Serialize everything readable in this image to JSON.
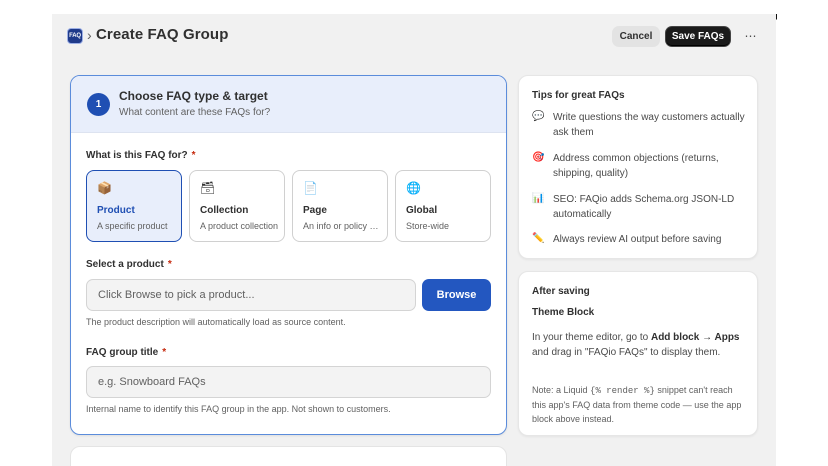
{
  "header": {
    "app_icon_text": "FAQ",
    "breadcrumb_sep": "›",
    "title": "Create FAQ Group",
    "cancel_label": "Cancel",
    "save_label": "Save FAQs",
    "more_label": "⋯"
  },
  "step": {
    "number": "1",
    "title": "Choose FAQ type & target",
    "subtitle": "What content are these FAQs for?"
  },
  "faq_type": {
    "label": "What is this FAQ for?",
    "required_mark": "*",
    "selected": "Product",
    "options": [
      {
        "name": "Product",
        "desc": "A specific product",
        "icon": "package-icon",
        "glyph": "📦"
      },
      {
        "name": "Collection",
        "desc": "A product collection",
        "icon": "collection-icon",
        "glyph": "🗃"
      },
      {
        "name": "Page",
        "desc": "An info or policy page",
        "icon": "page-icon",
        "glyph": "📄"
      },
      {
        "name": "Global",
        "desc": "Store-wide",
        "icon": "globe-icon",
        "glyph": "🌐"
      }
    ]
  },
  "product": {
    "label": "Select a product",
    "required_mark": "*",
    "placeholder": "Click Browse to pick a product...",
    "browse_label": "Browse",
    "help": "The product description will automatically load as source content."
  },
  "group_title": {
    "label": "FAQ group title",
    "required_mark": "*",
    "placeholder": "e.g. Snowboard FAQs",
    "help": "Internal name to identify this FAQ group in the app. Not shown to customers."
  },
  "tips": {
    "title": "Tips for great FAQs",
    "items": [
      {
        "icon": "speech-bubble-icon",
        "glyph": "💬",
        "text": "Write questions the way customers actually ask them"
      },
      {
        "icon": "target-icon",
        "glyph": "🎯",
        "text": "Address common objections (returns, shipping, quality)"
      },
      {
        "icon": "chart-icon",
        "glyph": "📊",
        "text": "SEO: FAQio adds Schema.org JSON-LD automatically"
      },
      {
        "icon": "pencil-icon",
        "glyph": "✏️",
        "text": "Always review AI output before saving"
      }
    ]
  },
  "after_saving": {
    "title": "After saving",
    "subtitle": "Theme Block",
    "body_pre": "In your theme editor, go to ",
    "body_bold": "Add block → Apps",
    "body_post": " and drag in \"FAQio FAQs\" to display them.",
    "note_pre": "Note: a Liquid ",
    "note_code": "{% render %}",
    "note_post": " snippet can't reach this app's FAQ data from theme code — use the app block above instead."
  },
  "colors": {
    "accent": "#1f4fb3",
    "accent_bg": "#e8eefb",
    "required": "#c5280c",
    "save_bg": "#1a1a1a"
  }
}
